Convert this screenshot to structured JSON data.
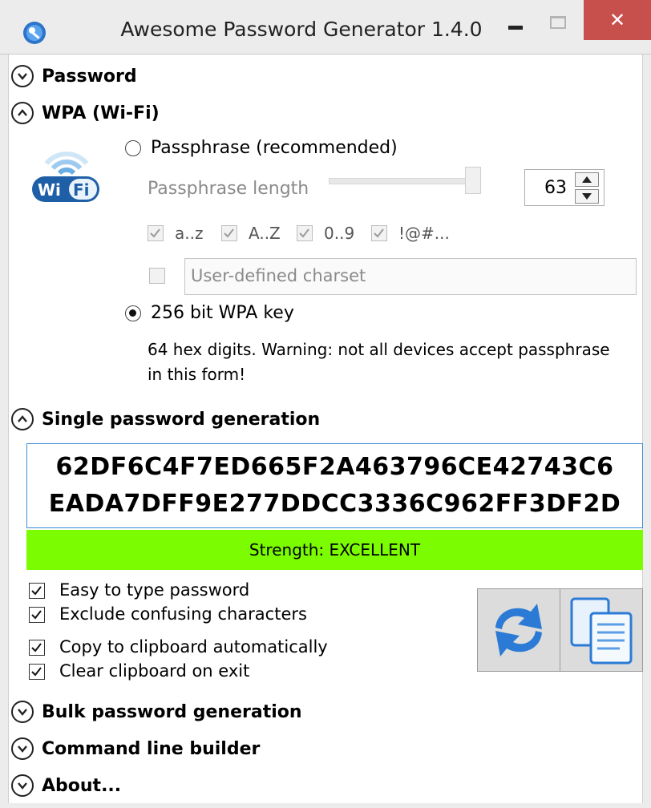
{
  "window": {
    "title": "Awesome Password Generator 1.4.0",
    "close_glyph": "✕"
  },
  "sections": {
    "password": {
      "label": "Password",
      "state": "collapsed"
    },
    "wpa": {
      "label": "WPA (Wi-Fi)",
      "state": "expanded"
    },
    "single": {
      "label": "Single password generation",
      "state": "expanded"
    },
    "bulk": {
      "label": "Bulk password generation",
      "state": "collapsed"
    },
    "cmdline": {
      "label": "Command line builder",
      "state": "collapsed"
    },
    "about": {
      "label": "About...",
      "state": "collapsed"
    }
  },
  "wpa": {
    "passphrase_radio_label": "Passphrase (recommended)",
    "passphrase_selected": false,
    "passphrase_length_label": "Passphrase length",
    "passphrase_length_value": "63",
    "slider_level": 1.0,
    "charsets": [
      {
        "label": "a..z",
        "checked": true
      },
      {
        "label": "A..Z",
        "checked": true
      },
      {
        "label": "0..9",
        "checked": true
      },
      {
        "label": "!@#...",
        "checked": true
      }
    ],
    "user_defined_checked": false,
    "user_defined_placeholder": "User-defined charset",
    "wpa_key_radio_label": "256 bit WPA key",
    "wpa_key_selected": true,
    "warning_line1": "64 hex digits. Warning: not all devices accept passphrase",
    "warning_line2": "in this form!"
  },
  "single": {
    "password_line1": "62DF6C4F7ED665F2A463796CE42743C6",
    "password_line2": "EADA7DFF9E277DDCC3336C962FF3DF2D",
    "strength_text": "Strength: EXCELLENT",
    "strength_color": "#7cfc00",
    "options": [
      {
        "label": "Easy to type password",
        "checked": true
      },
      {
        "label": "Exclude confusing characters",
        "checked": true
      },
      {
        "label": "Copy to clipboard automatically",
        "checked": true
      },
      {
        "label": "Clear clipboard on exit",
        "checked": true
      }
    ]
  },
  "icons": {
    "app": "globe-key-icon",
    "wifi": "wifi-logo-icon",
    "refresh": "refresh-icon",
    "copy": "copy-icon"
  },
  "colors": {
    "accent_blue": "#3b8ed8",
    "close_red": "#c7504d"
  }
}
